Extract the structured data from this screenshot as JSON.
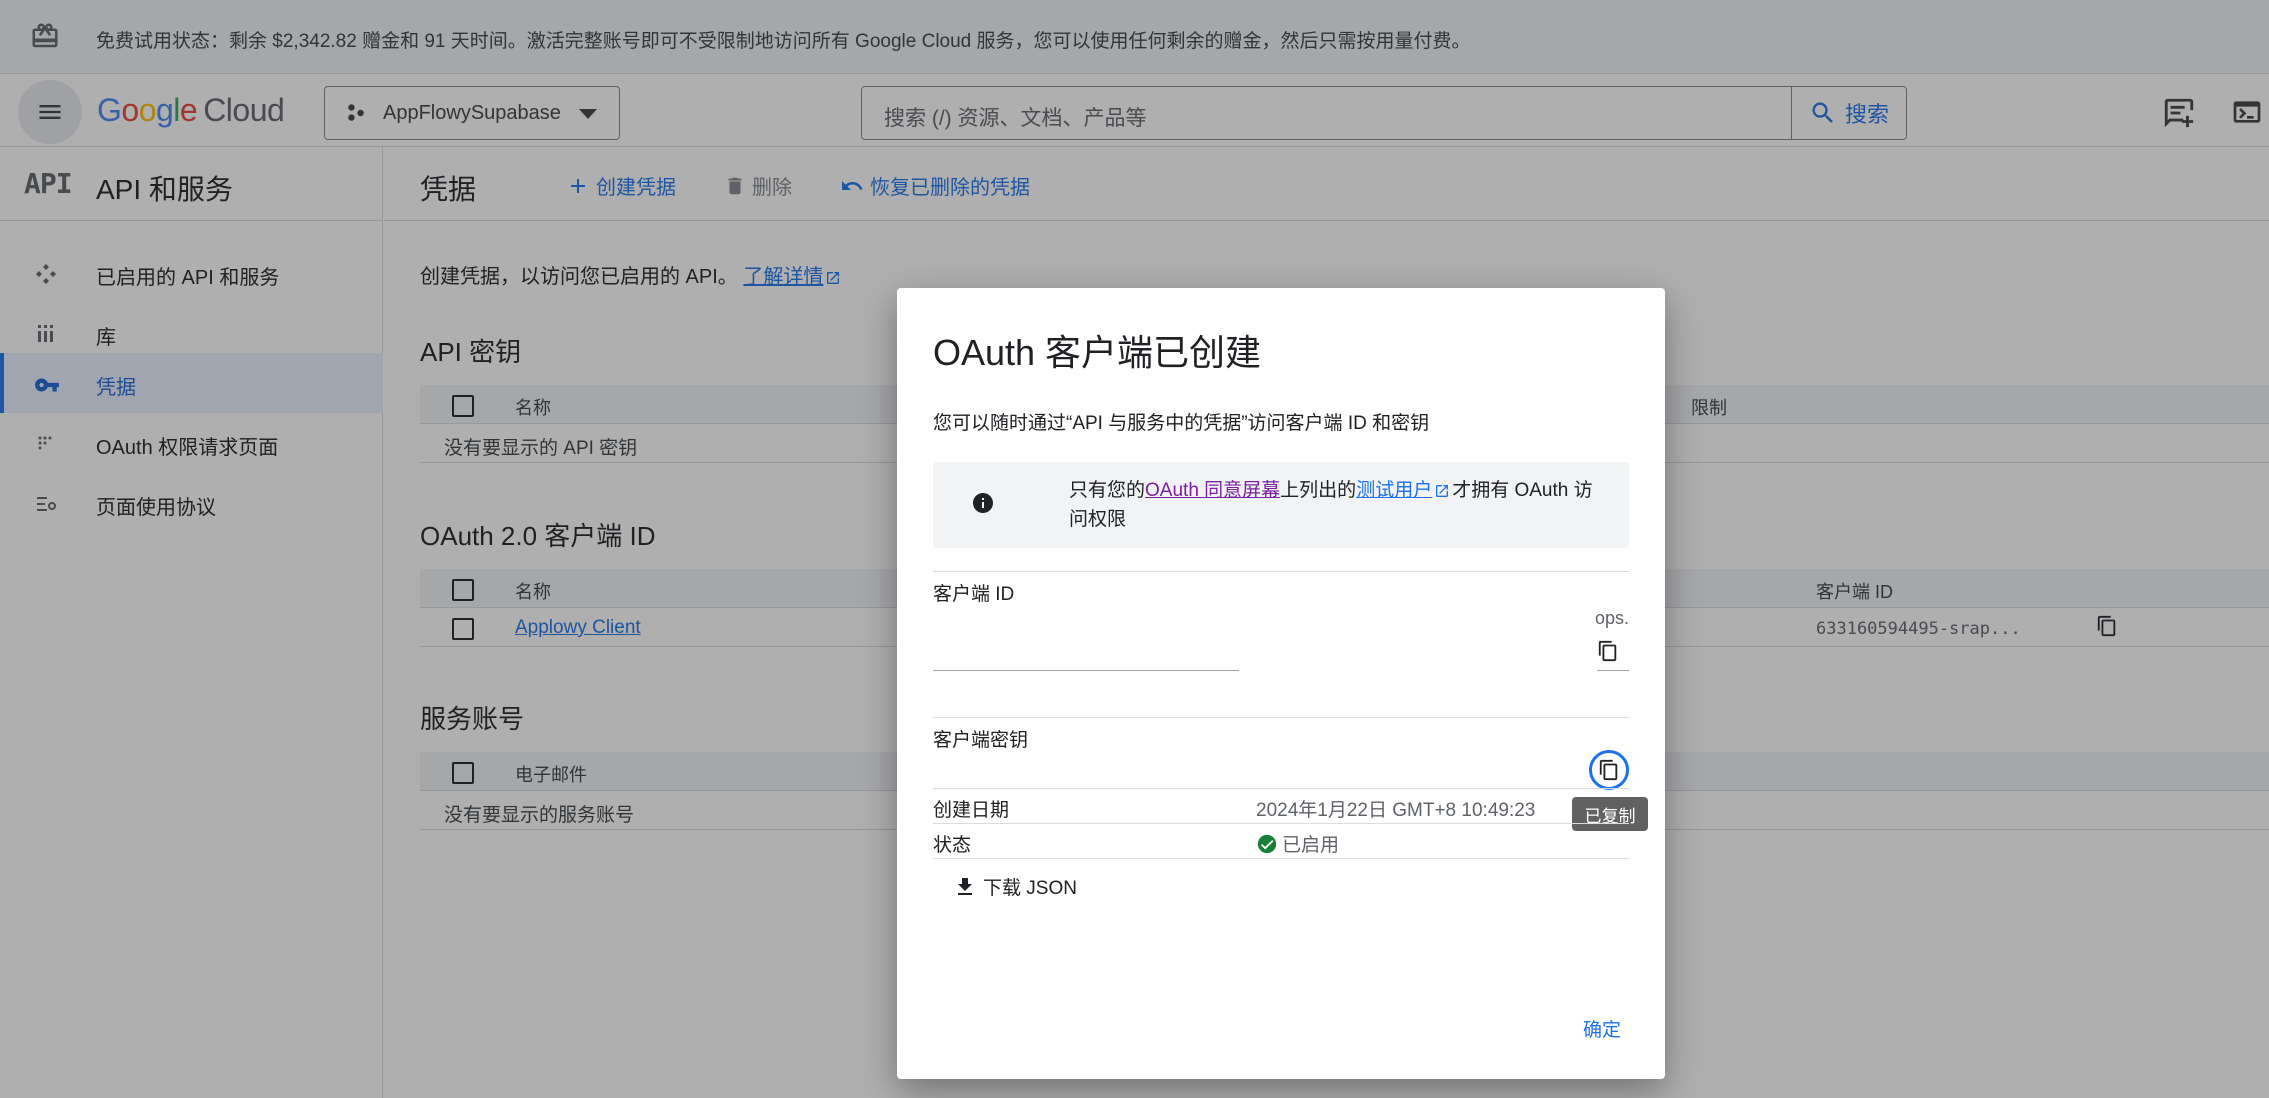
{
  "banner": {
    "text": "免费试用状态：剩余 $2,342.82 赠金和 91 天时间。激活完整账号即可不受限制地访问所有 Google Cloud 服务，您可以使用任何剩余的赠金，然后只需按用量付费。"
  },
  "header": {
    "logo": "Google",
    "logo_product": "Cloud",
    "project": "AppFlowySupabase",
    "search_placeholder": "搜索 (/) 资源、文档、产品等",
    "search_button": "搜索"
  },
  "nav": {
    "api_badge": "API",
    "title": "API 和服务",
    "items": [
      {
        "label": "已启用的 API 和服务",
        "icon": "api-hub-icon"
      },
      {
        "label": "库",
        "icon": "library-icon"
      },
      {
        "label": "凭据",
        "icon": "key-icon"
      },
      {
        "label": "OAuth 权限请求页面",
        "icon": "consent-icon"
      },
      {
        "label": "页面使用协议",
        "icon": "settings-list-icon"
      }
    ]
  },
  "main": {
    "page_title": "凭据",
    "actions": {
      "create": "创建凭据",
      "delete": "删除",
      "restore": "恢复已删除的凭据"
    },
    "intro": "创建凭据，以访问您已启用的 API。",
    "learn_more": "了解详情",
    "api_keys": {
      "title": "API 密钥",
      "col_name": "名称",
      "col_limit": "限制",
      "empty": "没有要显示的 API 密钥"
    },
    "oauth": {
      "title": "OAuth 2.0 客户端 ID",
      "col_name": "名称",
      "col_client_id": "客户端 ID",
      "rows": [
        {
          "name": "Applowy Client",
          "client_id": "633160594495-srap..."
        }
      ]
    },
    "service_accounts": {
      "title": "服务账号",
      "col_email": "电子邮件",
      "empty": "没有要显示的服务账号"
    }
  },
  "dialog": {
    "title": "OAuth 客户端已创建",
    "subtitle": "您可以随时通过“API 与服务中的凭据”访问客户端 ID 和密钥",
    "note_prefix": "只有您的",
    "note_link1": "OAuth 同意屏幕",
    "note_mid": "上列出的",
    "note_link2": "测试用户",
    "note_suffix": "才拥有 OAuth 访问权限",
    "client_id_label": "客户端 ID",
    "client_id_fragment": "ops.",
    "client_secret_label": "客户端密钥",
    "tooltip": "已复制",
    "created_label": "创建日期",
    "created_value": "2024年1月22日 GMT+8 10:49:23",
    "status_label": "状态",
    "status_value": "已启用",
    "download": "下载 JSON",
    "ok": "确定"
  },
  "colors": {
    "accent": "#1a73e8",
    "success": "#188038",
    "link_visited": "#7b1fa2"
  }
}
